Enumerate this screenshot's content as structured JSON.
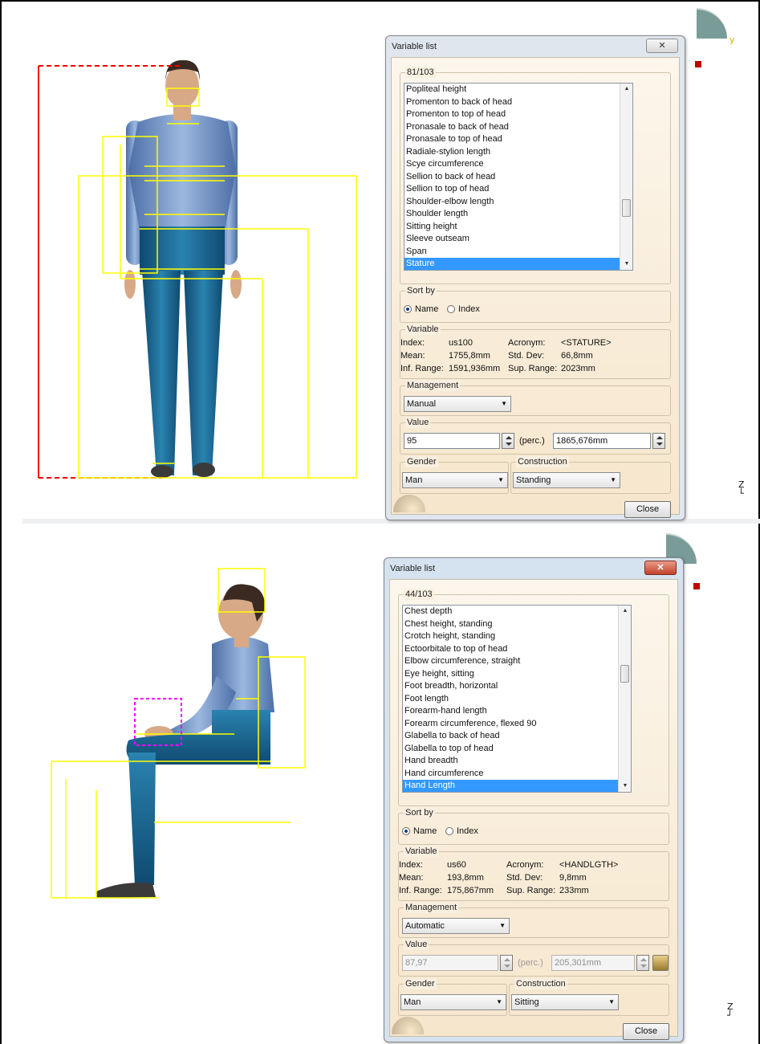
{
  "colors": {
    "dialog_bg": "#f6e6cc",
    "selection": "#3399ff",
    "measure_lines": "#ffff00",
    "stature_line": "#ff0000",
    "hand_box": "#ff00ff",
    "body_shirt": "#7b9ccc",
    "body_pants": "#1e6b96",
    "close_button_active": "#c2432b"
  },
  "top": {
    "viewport": {
      "axis_label": "Z",
      "compass_label": "y"
    },
    "dialog": {
      "title": "Variable list",
      "close_icon": "close-icon",
      "list_group_label": "81/103",
      "items": [
        "Popliteal height",
        "Promenton to back of head",
        "Promenton to top of head",
        "Pronasale to back of head",
        "Pronasale to top of head",
        "Radiale-stylion length",
        "Scye circumference",
        "Sellion to back of head",
        "Sellion to top of head",
        "Shoulder-elbow length",
        "Shoulder length",
        "Sitting height",
        "Sleeve outseam",
        "Span",
        "Stature"
      ],
      "selected_item": "Stature",
      "sort_label": "Sort by",
      "sort_name": "Name",
      "sort_index": "Index",
      "sort_selected": "Name",
      "variable_label": "Variable",
      "index_label": "Index:",
      "index_value": "us100",
      "acronym_label": "Acronym:",
      "acronym_value": "<STATURE>",
      "mean_label": "Mean:",
      "mean_value": "1755,8mm",
      "std_label": "Std. Dev:",
      "std_value": "66,8mm",
      "inf_label": "Inf. Range:",
      "inf_value": "1591,936mm",
      "sup_label": "Sup. Range:",
      "sup_value": "2023mm",
      "management_label": "Management",
      "management_value": "Manual",
      "value_label": "Value",
      "perc_value": "95",
      "perc_label": "(perc.)",
      "mm_value": "1865,676mm",
      "gender_label": "Gender",
      "gender_value": "Man",
      "construction_label": "Construction",
      "construction_value": "Standing",
      "close_label": "Close"
    }
  },
  "bottom": {
    "viewport": {
      "axis_label": "Z"
    },
    "dialog": {
      "title": "Variable list",
      "close_icon": "close-icon",
      "list_group_label": "44/103",
      "items": [
        "Chest depth",
        "Chest height, standing",
        "Crotch height, standing",
        "Ectoorbitale to top of head",
        "Elbow circumference, straight",
        "Eye height, sitting",
        "Foot breadth, horizontal",
        "Foot length",
        "Forearm-hand length",
        "Forearm circumference, flexed 90",
        "Glabella to back of head",
        "Glabella to top of head",
        "Hand breadth",
        "Hand circumference",
        "Hand Length"
      ],
      "selected_item": "Hand Length",
      "sort_label": "Sort by",
      "sort_name": "Name",
      "sort_index": "Index",
      "sort_selected": "Name",
      "variable_label": "Variable",
      "index_label": "Index:",
      "index_value": "us60",
      "acronym_label": "Acronym:",
      "acronym_value": "<HANDLGTH>",
      "mean_label": "Mean:",
      "mean_value": "193,8mm",
      "std_label": "Std. Dev:",
      "std_value": "9,8mm",
      "inf_label": "Inf. Range:",
      "inf_value": "175,867mm",
      "sup_label": "Sup. Range:",
      "sup_value": "233mm",
      "management_label": "Management",
      "management_value": "Automatic",
      "value_label": "Value",
      "perc_value": "87,97",
      "perc_label": "(perc.)",
      "mm_value": "205,301mm",
      "gender_label": "Gender",
      "gender_value": "Man",
      "construction_label": "Construction",
      "construction_value": "Sitting",
      "close_label": "Close"
    }
  }
}
